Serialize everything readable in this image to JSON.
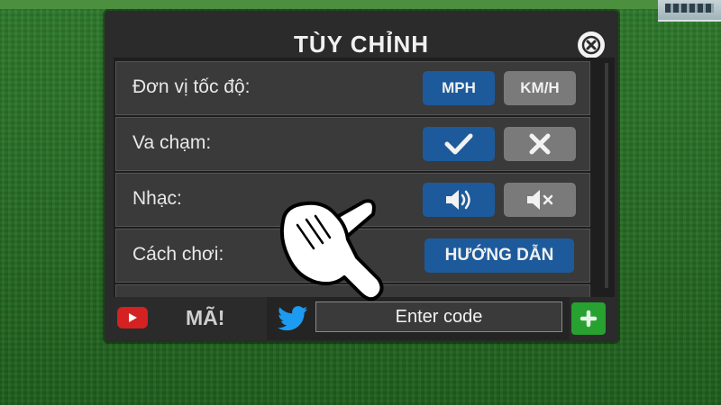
{
  "panel": {
    "title": "TÙY CHỈNH",
    "close_icon": "close-circle-icon"
  },
  "settings": [
    {
      "label": "Đơn vị tốc độ:",
      "options": [
        {
          "text": "MPH",
          "selected": true
        },
        {
          "text": "KM/H",
          "selected": false
        }
      ]
    },
    {
      "label": "Va chạm:",
      "options": [
        {
          "icon": "checkmark-icon",
          "selected": true
        },
        {
          "icon": "x-mark-icon",
          "selected": false
        }
      ]
    },
    {
      "label": "Nhạc:",
      "options": [
        {
          "icon": "speaker-on-icon",
          "selected": true
        },
        {
          "icon": "speaker-muted-icon",
          "selected": false
        }
      ]
    },
    {
      "label": "Cách chơi:",
      "button": "HƯỚNG DẪN"
    }
  ],
  "codes": {
    "label": "MÃ!",
    "placeholder": "Enter code",
    "youtube_icon": "youtube-icon",
    "twitter_icon": "twitter-icon",
    "add_icon": "plus-icon"
  },
  "colors": {
    "selected": "#1d5a9b",
    "unselected": "#7a7a7a",
    "add_button": "#27a12f",
    "youtube": "#d42121",
    "twitter": "#1d9bf0",
    "panel": "#2b2b2b"
  }
}
